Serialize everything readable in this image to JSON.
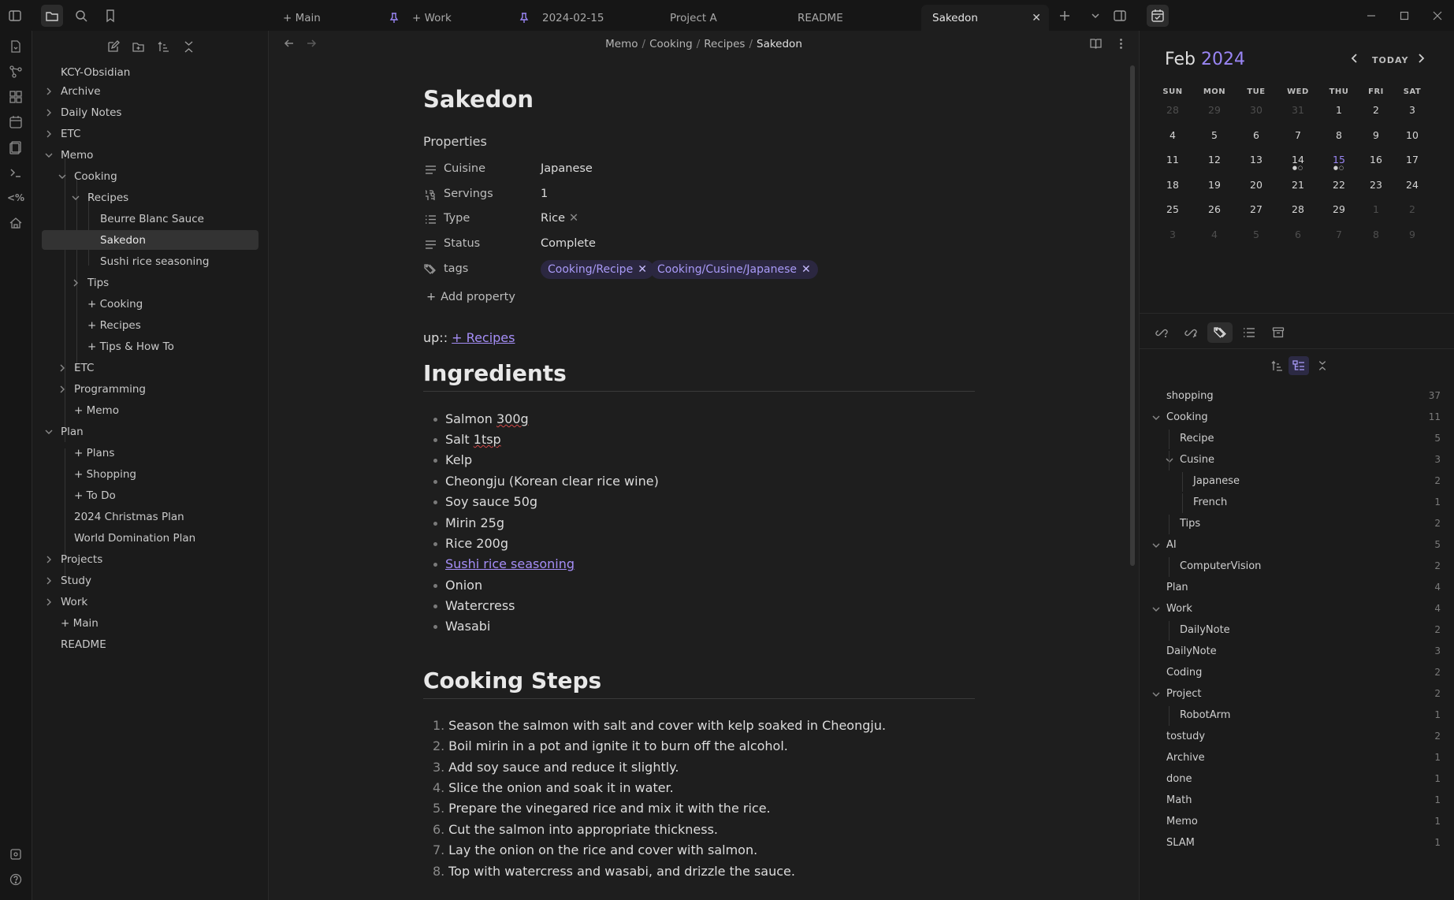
{
  "tabs": [
    {
      "label": "+ Main",
      "pinned": false,
      "active": false
    },
    {
      "label": "+ Work",
      "pinned": true,
      "active": false
    },
    {
      "label": "2024-02-15",
      "pinned": true,
      "active": false
    },
    {
      "label": "Project A",
      "pinned": false,
      "active": false
    },
    {
      "label": "README",
      "pinned": false,
      "active": false
    },
    {
      "label": "Sakedon",
      "pinned": false,
      "active": true
    }
  ],
  "explorer": {
    "vault_name": "KCY-Obsidian",
    "items": [
      {
        "label": "Archive",
        "type": "folder",
        "open": false
      },
      {
        "label": "Daily Notes",
        "type": "folder",
        "open": false
      },
      {
        "label": "ETC",
        "type": "folder",
        "open": false
      },
      {
        "label": "Memo",
        "type": "folder",
        "open": true
      },
      {
        "label": "Cooking",
        "type": "folder",
        "open": true
      },
      {
        "label": "Recipes",
        "type": "folder",
        "open": true
      },
      {
        "label": "Beurre Blanc Sauce",
        "type": "file"
      },
      {
        "label": "Sakedon",
        "type": "file",
        "selected": true
      },
      {
        "label": "Sushi rice seasoning",
        "type": "file"
      },
      {
        "label": "Tips",
        "type": "folder",
        "open": false
      },
      {
        "label": "+ Cooking",
        "type": "file"
      },
      {
        "label": "+ Recipes",
        "type": "file"
      },
      {
        "label": "+ Tips & How To",
        "type": "file"
      },
      {
        "label": "ETC",
        "type": "folder",
        "open": false
      },
      {
        "label": "Programming",
        "type": "folder",
        "open": false
      },
      {
        "label": "+ Memo",
        "type": "file"
      },
      {
        "label": "Plan",
        "type": "folder",
        "open": true
      },
      {
        "label": "+ Plans",
        "type": "file"
      },
      {
        "label": "+ Shopping",
        "type": "file"
      },
      {
        "label": "+ To Do",
        "type": "file"
      },
      {
        "label": "2024 Christmas Plan",
        "type": "file"
      },
      {
        "label": "World Domination Plan",
        "type": "file"
      },
      {
        "label": "Projects",
        "type": "folder",
        "open": false
      },
      {
        "label": "Study",
        "type": "folder",
        "open": false
      },
      {
        "label": "Work",
        "type": "folder",
        "open": false
      },
      {
        "label": "+ Main",
        "type": "file"
      },
      {
        "label": "README",
        "type": "file"
      }
    ]
  },
  "breadcrumb": {
    "parts": [
      "Memo",
      "Cooking",
      "Recipes"
    ],
    "current": "Sakedon"
  },
  "note": {
    "title": "Sakedon",
    "properties_heading": "Properties",
    "properties": [
      {
        "key": "Cuisine",
        "value": "Japanese",
        "icon": "text-lines-icon"
      },
      {
        "key": "Servings",
        "value": "1",
        "icon": "number-icon"
      },
      {
        "key": "Type",
        "value": "Rice",
        "icon": "list-icon"
      },
      {
        "key": "Status",
        "value": "Complete",
        "icon": "text-lines-icon"
      },
      {
        "key": "tags",
        "value": "",
        "icon": "tags-icon"
      }
    ],
    "tags": [
      "Cooking/Recipe",
      "Cooking/Cusine/Japanese"
    ],
    "add_property": "Add property",
    "up_prefix": "up::",
    "up_link": "+ Recipes",
    "ingredients_heading": "Ingredients",
    "ingredients": [
      "Salmon 300g",
      "Salt 1tsp",
      "Kelp",
      "Cheongju (Korean clear rice wine)",
      "Soy sauce 50g",
      "Mirin 25g",
      "Rice 200g",
      "Sushi rice seasoning",
      "Onion",
      "Watercress",
      "Wasabi"
    ],
    "steps_heading": "Cooking Steps",
    "steps": [
      "Season the salmon with salt and cover with kelp soaked in Cheongju.",
      "Boil mirin in a pot and ignite it to burn off the alcohol.",
      "Add soy sauce and reduce it slightly.",
      "Slice the onion and soak it in water.",
      "Prepare the vinegared rice and mix it with the rice.",
      "Cut the salmon into appropriate thickness.",
      "Lay the onion on the rice and cover with salmon.",
      "Top with watercress and wasabi, and drizzle the sauce."
    ]
  },
  "calendar": {
    "month": "Feb",
    "year": "2024",
    "today_label": "TODAY",
    "weekdays": [
      "SUN",
      "MON",
      "TUE",
      "WED",
      "THU",
      "FRI",
      "SAT"
    ],
    "weeks": [
      [
        "28",
        "29",
        "30",
        "31",
        "1",
        "2",
        "3"
      ],
      [
        "4",
        "5",
        "6",
        "7",
        "8",
        "9",
        "10"
      ],
      [
        "11",
        "12",
        "13",
        "14",
        "15",
        "16",
        "17"
      ],
      [
        "18",
        "19",
        "20",
        "21",
        "22",
        "23",
        "24"
      ],
      [
        "25",
        "26",
        "27",
        "28",
        "29",
        "1",
        "2"
      ],
      [
        "3",
        "4",
        "5",
        "6",
        "7",
        "8",
        "9"
      ]
    ],
    "today_day": "15",
    "days_with_dots": [
      "14",
      "15"
    ]
  },
  "tags_panel": {
    "items": [
      {
        "name": "shopping",
        "count": "37",
        "level": 0,
        "chevron": false
      },
      {
        "name": "Cooking",
        "count": "11",
        "level": 0,
        "chevron": true
      },
      {
        "name": "Recipe",
        "count": "5",
        "level": 1,
        "chevron": false
      },
      {
        "name": "Cusine",
        "count": "3",
        "level": 1,
        "chevron": true
      },
      {
        "name": "Japanese",
        "count": "2",
        "level": 2,
        "chevron": false
      },
      {
        "name": "French",
        "count": "1",
        "level": 2,
        "chevron": false
      },
      {
        "name": "Tips",
        "count": "2",
        "level": 1,
        "chevron": false
      },
      {
        "name": "AI",
        "count": "5",
        "level": 0,
        "chevron": true
      },
      {
        "name": "ComputerVision",
        "count": "2",
        "level": 1,
        "chevron": false
      },
      {
        "name": "Plan",
        "count": "4",
        "level": 0,
        "chevron": false
      },
      {
        "name": "Work",
        "count": "4",
        "level": 0,
        "chevron": true
      },
      {
        "name": "DailyNote",
        "count": "2",
        "level": 1,
        "chevron": false
      },
      {
        "name": "DailyNote",
        "count": "3",
        "level": 0,
        "chevron": false
      },
      {
        "name": "Coding",
        "count": "2",
        "level": 0,
        "chevron": false
      },
      {
        "name": "Project",
        "count": "2",
        "level": 0,
        "chevron": true
      },
      {
        "name": "RobotArm",
        "count": "1",
        "level": 1,
        "chevron": false
      },
      {
        "name": "tostudy",
        "count": "2",
        "level": 0,
        "chevron": false
      },
      {
        "name": "Archive",
        "count": "1",
        "level": 0,
        "chevron": false
      },
      {
        "name": "done",
        "count": "1",
        "level": 0,
        "chevron": false
      },
      {
        "name": "Math",
        "count": "1",
        "level": 0,
        "chevron": false
      },
      {
        "name": "Memo",
        "count": "1",
        "level": 0,
        "chevron": false
      },
      {
        "name": "SLAM",
        "count": "1",
        "level": 0,
        "chevron": false
      }
    ]
  },
  "colors": {
    "accent": "#9a86f5",
    "background": "#1e1e1e",
    "sidebar": "#1b1b1b"
  }
}
